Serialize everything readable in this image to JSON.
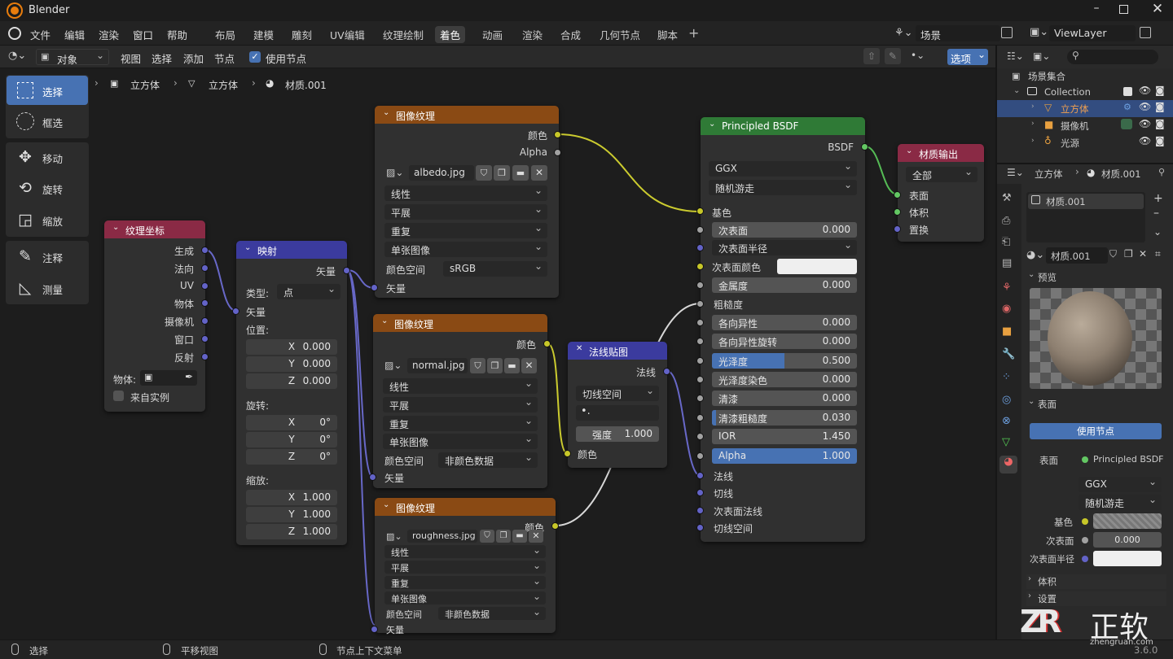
{
  "app": {
    "name": "Blender",
    "version": "3.6.0"
  },
  "menu": [
    "文件",
    "编辑",
    "渲染",
    "窗口",
    "帮助"
  ],
  "workspaces": [
    "布局",
    "建模",
    "雕刻",
    "UV编辑",
    "纹理绘制",
    "着色",
    "动画",
    "渲染",
    "合成",
    "几何节点",
    "脚本"
  ],
  "active_workspace": "着色",
  "scene": {
    "name": "场景",
    "viewlayer": "ViewLayer"
  },
  "header": {
    "mode": "对象",
    "menus": [
      "视图",
      "选择",
      "添加",
      "节点"
    ],
    "use_nodes": "使用节点",
    "options": "选项"
  },
  "breadcrumb": [
    "立方体",
    "立方体",
    "材质.001"
  ],
  "tools": [
    {
      "label": "选择",
      "icon": "select-box-icon",
      "active": true
    },
    {
      "label": "框选",
      "icon": "select-circle-icon"
    },
    {
      "label": "移动",
      "icon": "move-icon"
    },
    {
      "label": "旋转",
      "icon": "rotate-icon"
    },
    {
      "label": "缩放",
      "icon": "scale-icon"
    },
    {
      "label": "注释",
      "icon": "annotate-icon"
    },
    {
      "label": "测量",
      "icon": "measure-icon"
    }
  ],
  "nodes": {
    "texcoord": {
      "title": "纹理坐标",
      "outputs": [
        "生成",
        "法向",
        "UV",
        "物体",
        "摄像机",
        "窗口",
        "反射"
      ],
      "object_label": "物体:",
      "from_instancer": "来自实例"
    },
    "mapping": {
      "title": "映射",
      "output": "矢量",
      "type_label": "类型:",
      "type_value": "点",
      "input": "矢量",
      "location": "位置:",
      "rotation": "旋转:",
      "scale": "缩放:",
      "axes": [
        "X",
        "Y",
        "Z"
      ],
      "loc": [
        "0.000",
        "0.000",
        "0.000"
      ],
      "rot": [
        "0°",
        "0°",
        "0°"
      ],
      "scl": [
        "1.000",
        "1.000",
        "1.000"
      ]
    },
    "img1": {
      "title": "图像纹理",
      "outputs": [
        "颜色",
        "Alpha"
      ],
      "file": "albedo.jpg",
      "interp": "线性",
      "proj": "平展",
      "ext": "重复",
      "source": "单张图像",
      "cs_label": "颜色空间",
      "cs": "sRGB",
      "input": "矢量"
    },
    "img2": {
      "title": "图像纹理",
      "output": "颜色",
      "file": "normal.jpg",
      "interp": "线性",
      "proj": "平展",
      "ext": "重复",
      "source": "单张图像",
      "cs_label": "颜色空间",
      "cs": "非颜色数据",
      "input": "矢量"
    },
    "img3": {
      "title": "图像纹理",
      "output": "颜色",
      "file": "roughness.jpg",
      "interp": "线性",
      "proj": "平展",
      "ext": "重复",
      "source": "单张图像",
      "cs_label": "颜色空间",
      "cs": "非颜色数据",
      "input": "矢量"
    },
    "normalmap": {
      "title": "法线贴图",
      "output": "法线",
      "space": "切线空间",
      "strength_label": "强度",
      "strength": "1.000",
      "input": "颜色"
    },
    "bsdf": {
      "title": "Principled BSDF",
      "output": "BSDF",
      "dist": "GGX",
      "sss": "随机游走",
      "base": "基色",
      "subsurface": "次表面",
      "subsurface_val": "0.000",
      "sss_radius": "次表面半径",
      "sss_color": "次表面颜色",
      "metallic": "金属度",
      "metallic_val": "0.000",
      "roughness": "粗糙度",
      "aniso": "各向异性",
      "aniso_val": "0.000",
      "aniso_rot": "各向异性旋转",
      "aniso_rot_val": "0.000",
      "sheen": "光泽度",
      "sheen_val": "0.500",
      "sheen_tint": "光泽度染色",
      "sheen_tint_val": "0.000",
      "clearcoat": "清漆",
      "clearcoat_val": "0.000",
      "cc_rough": "清漆粗糙度",
      "cc_rough_val": "0.030",
      "ior": "IOR",
      "ior_val": "1.450",
      "alpha": "Alpha",
      "alpha_val": "1.000",
      "normal": "法线",
      "tangent": "切线",
      "cc_normal": "次表面法线",
      "tangent_space": "切线空间"
    },
    "output": {
      "title": "材质输出",
      "target": "全部",
      "inputs": [
        "表面",
        "体积",
        "置换"
      ]
    }
  },
  "outliner": {
    "root": "场景集合",
    "collection": "Collection",
    "items": [
      "立方体",
      "摄像机",
      "光源"
    ]
  },
  "properties": {
    "breadcrumb": [
      "立方体",
      "材质.001"
    ],
    "slot": "材质.001",
    "material": "材质.001",
    "preview": "预览",
    "surface": "表面",
    "use_nodes": "使用节点",
    "surface_label": "表面",
    "surface_value": "Principled BSDF",
    "dist": "GGX",
    "sss": "随机游走",
    "base": "基色",
    "subsurface": "次表面",
    "subsurface_val": "0.000",
    "sss_radius": "次表面半径",
    "volume": "体积",
    "settings": "设置"
  },
  "status": [
    "选择",
    "平移视图",
    "节点上下文菜单"
  ],
  "watermark": {
    "brand": "正软",
    "url": "zhengruan.com"
  }
}
